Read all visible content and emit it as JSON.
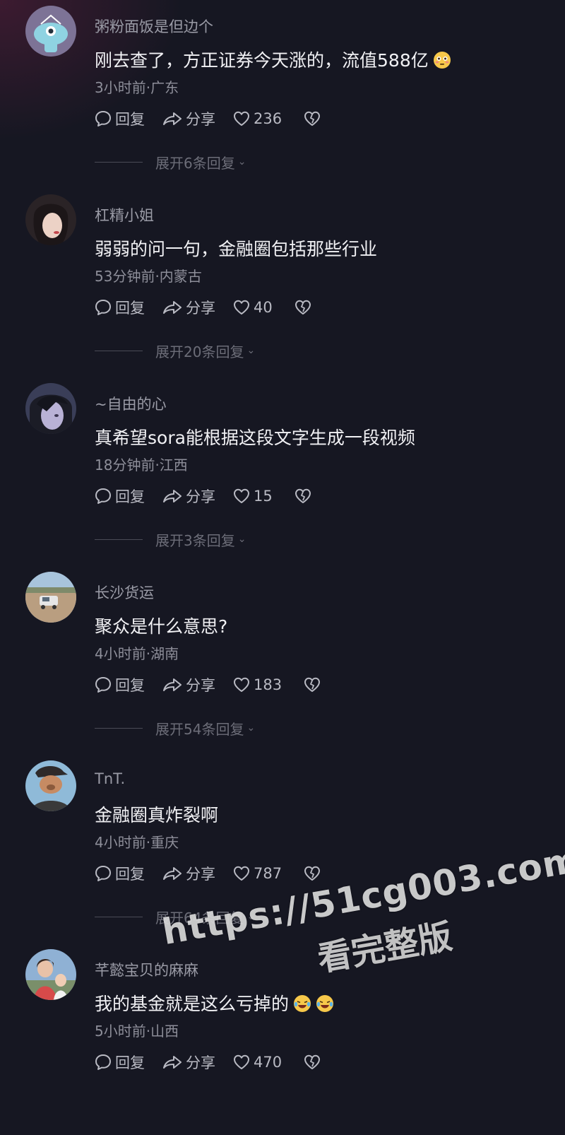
{
  "colors": {
    "background": "#161722",
    "text_primary": "#f1f1f4",
    "text_secondary": "#9a9ba6",
    "text_muted": "#6c6d78"
  },
  "actions": {
    "reply_label": "回复",
    "share_label": "分享"
  },
  "comments": [
    {
      "username": "粥粉面饭是但边个",
      "text": "刚去查了，方正证券今天涨的，流值588亿",
      "emoji": "flushed-face-emoji",
      "meta": "3小时前·广东",
      "likes": "236",
      "expand": "展开6条回复",
      "avatar_icon": "blue-mascot-avatar"
    },
    {
      "username": "杠精小姐",
      "text": "弱弱的问一句，金融圈包括那些行业",
      "meta": "53分钟前·内蒙古",
      "likes": "40",
      "expand": "展开20条回复",
      "avatar_icon": "woman-portrait-avatar"
    },
    {
      "username": "~自由的心",
      "text": "真希望sora能根据这段文字生成一段视频",
      "meta": "18分钟前·江西",
      "likes": "15",
      "expand": "展开3条回复",
      "avatar_icon": "anime-character-avatar"
    },
    {
      "username": "长沙货运",
      "text": "聚众是什么意思?",
      "meta": "4小时前·湖南",
      "likes": "183",
      "expand": "展开54条回复",
      "avatar_icon": "truck-outdoor-avatar"
    },
    {
      "username": "TnT.",
      "text": "金融圈真炸裂啊",
      "meta": "4小时前·重庆",
      "likes": "787",
      "expand": "展开64条回复",
      "avatar_icon": "character-with-cap-avatar"
    },
    {
      "username": "芊懿宝贝的麻麻",
      "text": "我的基金就是这么亏掉的",
      "emoji": "laughing-tears-emoji",
      "meta": "5小时前·山西",
      "likes": "470",
      "avatar_icon": "mother-and-child-avatar"
    }
  ],
  "watermark": {
    "url": "https://51cg003.com",
    "subtitle": "看完整版"
  }
}
